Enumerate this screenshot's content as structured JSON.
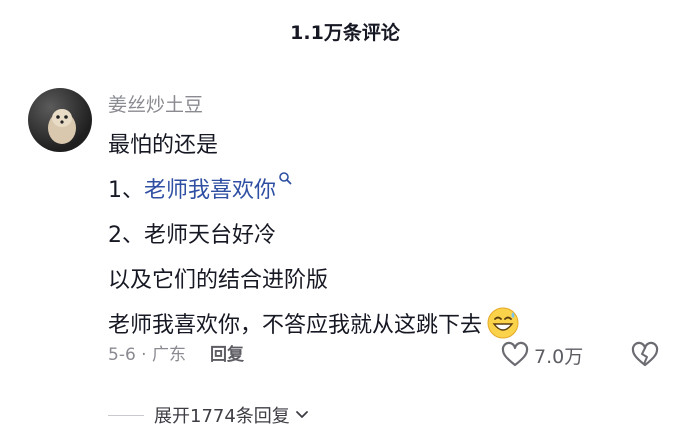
{
  "header": {
    "title": "1.1万条评论"
  },
  "comment": {
    "username": "姜丝炒土豆",
    "lines": [
      "最怕的还是",
      "1、",
      "老师我喜欢你",
      "2、老师天台好冷",
      "以及它们的结合进阶版",
      "老师我喜欢你，不答应我就从这跳下去"
    ],
    "date": "5-6",
    "location": "广东",
    "reply_label": "回复",
    "likes": "7.0万"
  },
  "expand": {
    "label": "展开1774条回复"
  },
  "icons": {
    "search": "search-icon",
    "emoji": "grinning-sweat-emoji",
    "like": "heart-icon",
    "dislike": "broken-heart-icon",
    "chevron": "chevron-down-icon"
  },
  "colors": {
    "link": "#2f4fa3",
    "muted": "#8a8b91",
    "text": "#161823"
  }
}
